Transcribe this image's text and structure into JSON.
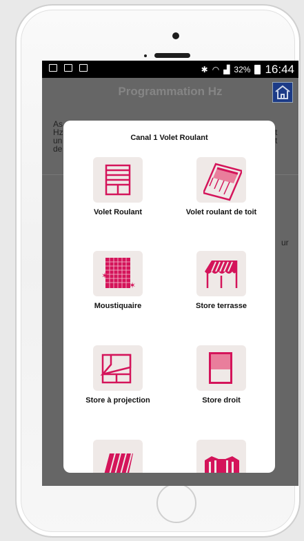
{
  "status_bar": {
    "battery": "32%",
    "time": "16:44"
  },
  "app_bar": {
    "title": "Programmation Hz"
  },
  "background": {
    "text_left": [
      "As",
      "Hz",
      "un",
      "de"
    ],
    "text_right": [
      "t",
      "t"
    ],
    "text_side": "ur"
  },
  "dialog": {
    "title": "Canal 1 Volet Roulant",
    "options": [
      {
        "label": "Volet Roulant",
        "icon": "volet-roulant-icon"
      },
      {
        "label": "Volet roulant de toit",
        "icon": "volet-roulant-de-toit-icon"
      },
      {
        "label": "Moustiquaire",
        "icon": "moustiquaire-icon"
      },
      {
        "label": "Store terrasse",
        "icon": "store-terrasse-icon"
      },
      {
        "label": "Store à projection",
        "icon": "store-a-projection-icon"
      },
      {
        "label": "Store droit",
        "icon": "store-droit-icon"
      },
      {
        "label": "",
        "icon": "store-banne-icon"
      },
      {
        "label": "",
        "icon": "portail-icon"
      }
    ]
  },
  "colors": {
    "accent": "#d4145a",
    "dialog_bg": "#ffffff",
    "tile_bg": "#efe9e7",
    "appbar": "#666666",
    "home_button": "#1c3b87"
  }
}
